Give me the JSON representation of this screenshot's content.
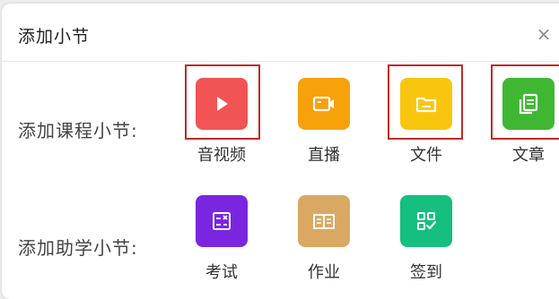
{
  "dialog": {
    "title": "添加小节",
    "close_symbol": "×"
  },
  "course_section": {
    "label": "添加课程小节:",
    "items": [
      {
        "label": "音视频",
        "icon": "play-icon",
        "color": "#f25455"
      },
      {
        "label": "直播",
        "icon": "video-camera-icon",
        "color": "#f7a10b"
      },
      {
        "label": "文件",
        "icon": "folder-icon",
        "color": "#f9c60f"
      },
      {
        "label": "文章",
        "icon": "document-copy-icon",
        "color": "#40b733"
      }
    ]
  },
  "assist_section": {
    "label": "添加助学小节:",
    "items": [
      {
        "label": "考试",
        "icon": "exam-icon",
        "color": "#7a26e0"
      },
      {
        "label": "作业",
        "icon": "book-icon",
        "color": "#d9a963"
      },
      {
        "label": "签到",
        "icon": "qr-checkin-icon",
        "color": "#15bf80"
      }
    ]
  },
  "highlight_color": "#c02a2a"
}
